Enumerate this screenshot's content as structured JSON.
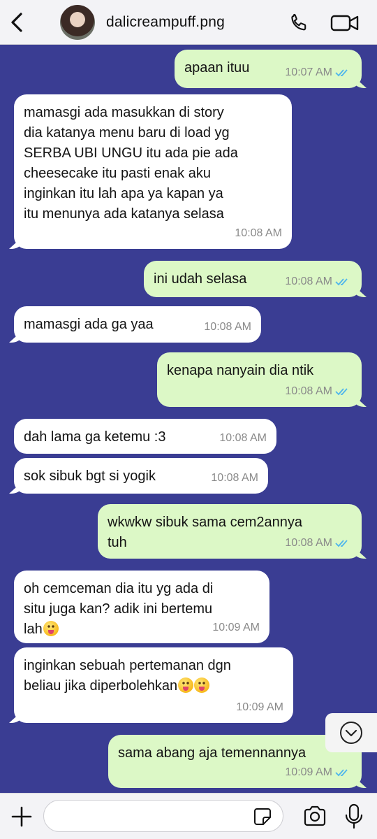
{
  "header": {
    "contact_name": "dalicreampuff.png",
    "back_icon": "chevron-left-icon",
    "call_icon": "phone-icon",
    "video_icon": "video-camera-icon"
  },
  "messages": [
    {
      "direction": "outgoing",
      "lines": [
        "apaan ituu"
      ],
      "time": "10:07 AM",
      "read": true
    },
    {
      "direction": "incoming",
      "lines": [
        "mamasgi ada masukkan di story",
        "dia katanya menu baru di load yg",
        "SERBA UBI UNGU itu ada pie ada",
        "cheesecake itu pasti enak aku",
        "inginkan itu lah apa ya kapan ya",
        "itu menunya ada katanya selasa"
      ],
      "time": "10:08 AM"
    },
    {
      "direction": "outgoing",
      "lines": [
        "ini udah selasa"
      ],
      "time": "10:08 AM",
      "read": true
    },
    {
      "direction": "incoming",
      "lines": [
        "mamasgi ada ga yaa"
      ],
      "time": "10:08 AM"
    },
    {
      "direction": "outgoing",
      "lines": [
        "kenapa nanyain dia ntik"
      ],
      "time": "10:08 AM",
      "read": true
    },
    {
      "direction": "incoming",
      "lines": [
        "dah lama ga ketemu :3"
      ],
      "time": "10:08 AM"
    },
    {
      "direction": "incoming",
      "lines": [
        "sok sibuk bgt si yogik"
      ],
      "time": "10:08 AM"
    },
    {
      "direction": "outgoing",
      "lines": [
        "wkwkw sibuk sama cem2annya",
        "tuh"
      ],
      "time": "10:08 AM",
      "read": true
    },
    {
      "direction": "incoming",
      "lines": [
        "oh cemceman dia itu yg ada di",
        "situ juga kan? adik ini bertemu",
        "lah"
      ],
      "emoji": "tongue-out-emoji",
      "time": "10:09 AM"
    },
    {
      "direction": "incoming",
      "lines": [
        "inginkan sebuah pertemanan dgn",
        "beliau jika diperbolehkan"
      ],
      "emoji": "tongue-out-emoji x2",
      "time": "10:09 AM"
    },
    {
      "direction": "outgoing",
      "lines": [
        "sama abang aja temennannya"
      ],
      "time": "10:09 AM",
      "read": true
    }
  ],
  "scroll_down_icon": "chevron-down-circle-icon",
  "composer": {
    "placeholder": "",
    "value": "",
    "plus_icon": "plus-icon",
    "sticker_icon": "sticker-icon",
    "camera_icon": "camera-icon",
    "mic_icon": "microphone-icon"
  },
  "colors": {
    "chat_background": "#3a3d93",
    "incoming_bubble": "#ffffff",
    "outgoing_bubble": "#dcf8c6",
    "read_ticks": "#4fb6ec",
    "header_background": "#f3f3f6"
  }
}
